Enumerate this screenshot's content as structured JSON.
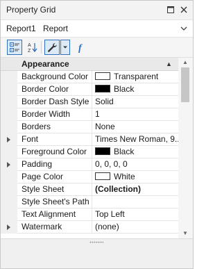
{
  "window": {
    "title": "Property Grid"
  },
  "object_selector": {
    "name": "Report1",
    "type": "Report"
  },
  "toolbar": {
    "buttons": [
      {
        "name": "categorized-view",
        "active": true
      },
      {
        "name": "alphabetical-sort",
        "active": false
      },
      {
        "name": "properties-tab",
        "active": true
      },
      {
        "name": "events-tab",
        "active": false
      }
    ]
  },
  "grid": {
    "category": "Appearance",
    "properties": [
      {
        "name": "Background Color",
        "value": "Transparent",
        "swatch": "#ffffff",
        "expandable": false,
        "bold": false
      },
      {
        "name": "Border Color",
        "value": "Black",
        "swatch": "#000000",
        "expandable": false,
        "bold": false
      },
      {
        "name": "Border Dash Style",
        "value": "Solid",
        "expandable": false,
        "bold": false
      },
      {
        "name": "Border Width",
        "value": "1",
        "expandable": false,
        "bold": false
      },
      {
        "name": "Borders",
        "value": "None",
        "expandable": false,
        "bold": false
      },
      {
        "name": "Font",
        "value": "Times New Roman, 9...",
        "expandable": true,
        "bold": false
      },
      {
        "name": "Foreground Color",
        "value": "Black",
        "swatch": "#000000",
        "expandable": false,
        "bold": false
      },
      {
        "name": "Padding",
        "value": "0, 0, 0, 0",
        "expandable": true,
        "bold": false
      },
      {
        "name": "Page Color",
        "value": "White",
        "swatch": "#ffffff",
        "expandable": false,
        "bold": false
      },
      {
        "name": "Style Sheet",
        "value": "(Collection)",
        "expandable": false,
        "bold": true
      },
      {
        "name": "Style Sheet's Path",
        "value": "",
        "expandable": false,
        "bold": false
      },
      {
        "name": "Text Alignment",
        "value": "Top Left",
        "expandable": false,
        "bold": false
      },
      {
        "name": "Watermark",
        "value": "(none)",
        "expandable": true,
        "bold": false
      }
    ]
  },
  "colors": {
    "accent": "#2f6fbf",
    "category_bg": "#e9e9e9"
  }
}
